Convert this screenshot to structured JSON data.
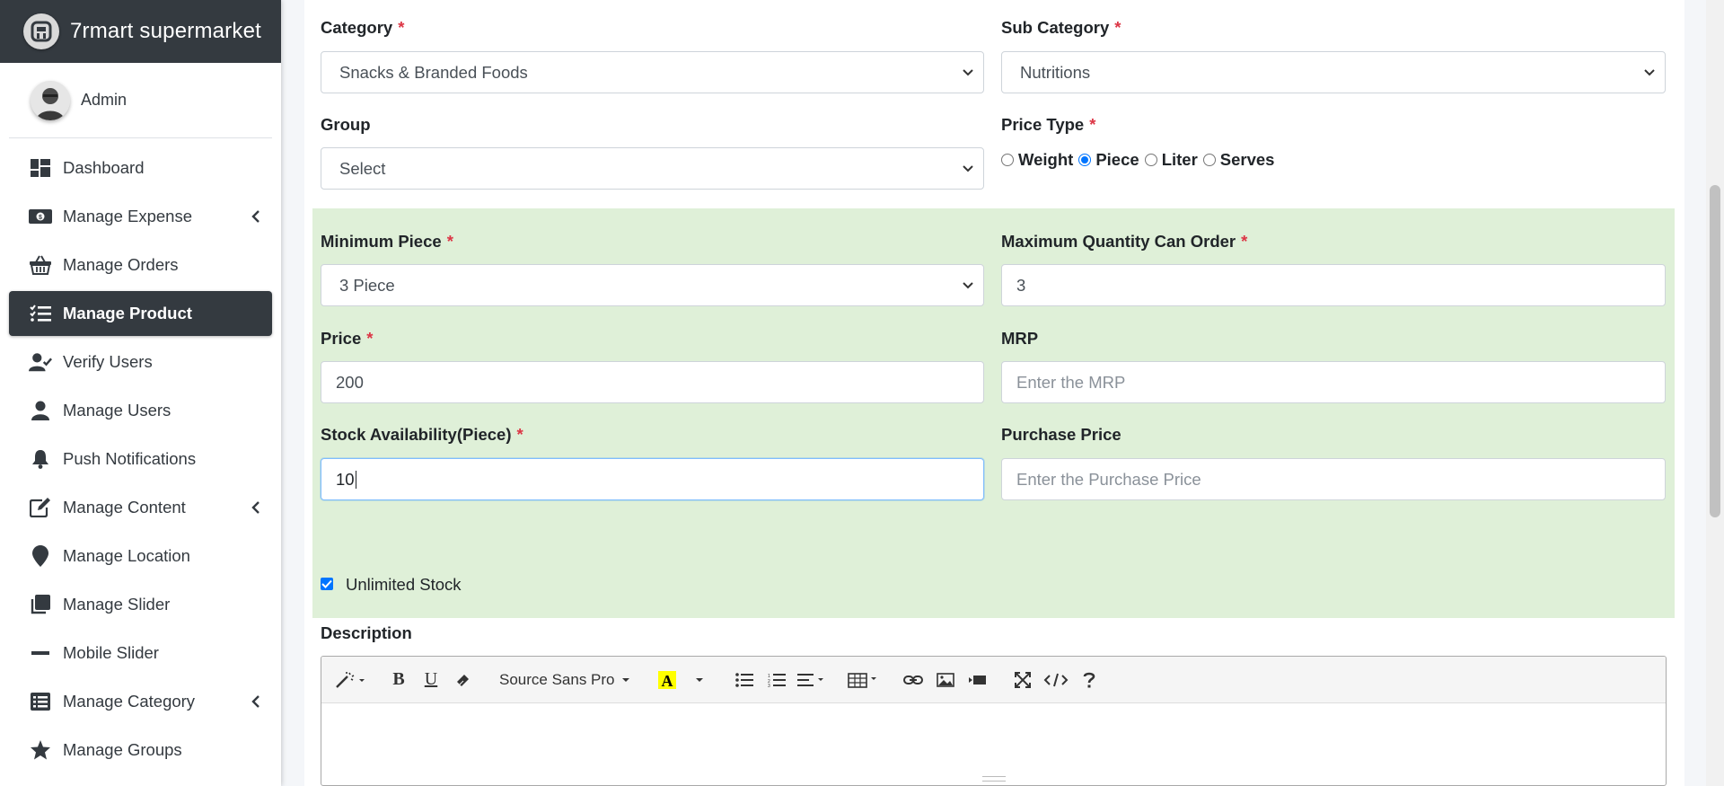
{
  "brand": {
    "name": "7rmart supermarket"
  },
  "user": {
    "name": "Admin"
  },
  "sidebar": {
    "items": [
      {
        "label": "Dashboard",
        "icon": "dashboard-icon"
      },
      {
        "label": "Manage Expense",
        "icon": "money-icon",
        "expandable": true
      },
      {
        "label": "Manage Orders",
        "icon": "basket-icon"
      },
      {
        "label": "Manage Product",
        "icon": "tasks-icon",
        "active": true
      },
      {
        "label": "Verify Users",
        "icon": "user-check-icon"
      },
      {
        "label": "Manage Users",
        "icon": "user-icon"
      },
      {
        "label": "Push Notifications",
        "icon": "bell-icon"
      },
      {
        "label": "Manage Content",
        "icon": "edit-icon",
        "expandable": true
      },
      {
        "label": "Manage Location",
        "icon": "map-marker-icon"
      },
      {
        "label": "Manage Slider",
        "icon": "slider-icon"
      },
      {
        "label": "Mobile Slider",
        "icon": "minus-icon"
      },
      {
        "label": "Manage Category",
        "icon": "list-icon",
        "expandable": true
      },
      {
        "label": "Manage Groups",
        "icon": "star-icon"
      }
    ]
  },
  "form": {
    "category": {
      "label": "Category",
      "value": "Snacks & Branded Foods"
    },
    "sub_category": {
      "label": "Sub Category",
      "value": "Nutritions"
    },
    "group": {
      "label": "Group",
      "value": "Select"
    },
    "price_type": {
      "label": "Price Type",
      "options": [
        "Weight",
        "Piece",
        "Liter",
        "Serves"
      ],
      "selected": "Piece"
    },
    "minimum_piece": {
      "label": "Minimum Piece",
      "value": "3 Piece"
    },
    "max_quantity": {
      "label": "Maximum Quantity Can Order",
      "value": "3"
    },
    "price": {
      "label": "Price",
      "value": "200"
    },
    "mrp": {
      "label": "MRP",
      "placeholder": "Enter the MRP"
    },
    "stock": {
      "label": "Stock Availability(Piece)",
      "value": "10"
    },
    "purchase_price": {
      "label": "Purchase Price",
      "placeholder": "Enter the Purchase Price"
    },
    "unlimited_stock": {
      "label": "Unlimited Stock",
      "checked": true
    },
    "description": {
      "label": "Description"
    },
    "required_marker": "*"
  },
  "editor": {
    "font_name": "Source Sans Pro"
  },
  "colors": {
    "sidebar_dark": "#343a40",
    "panel_green": "#dff0d8",
    "required_red": "#dc3545",
    "accent_blue": "#0075ff"
  }
}
